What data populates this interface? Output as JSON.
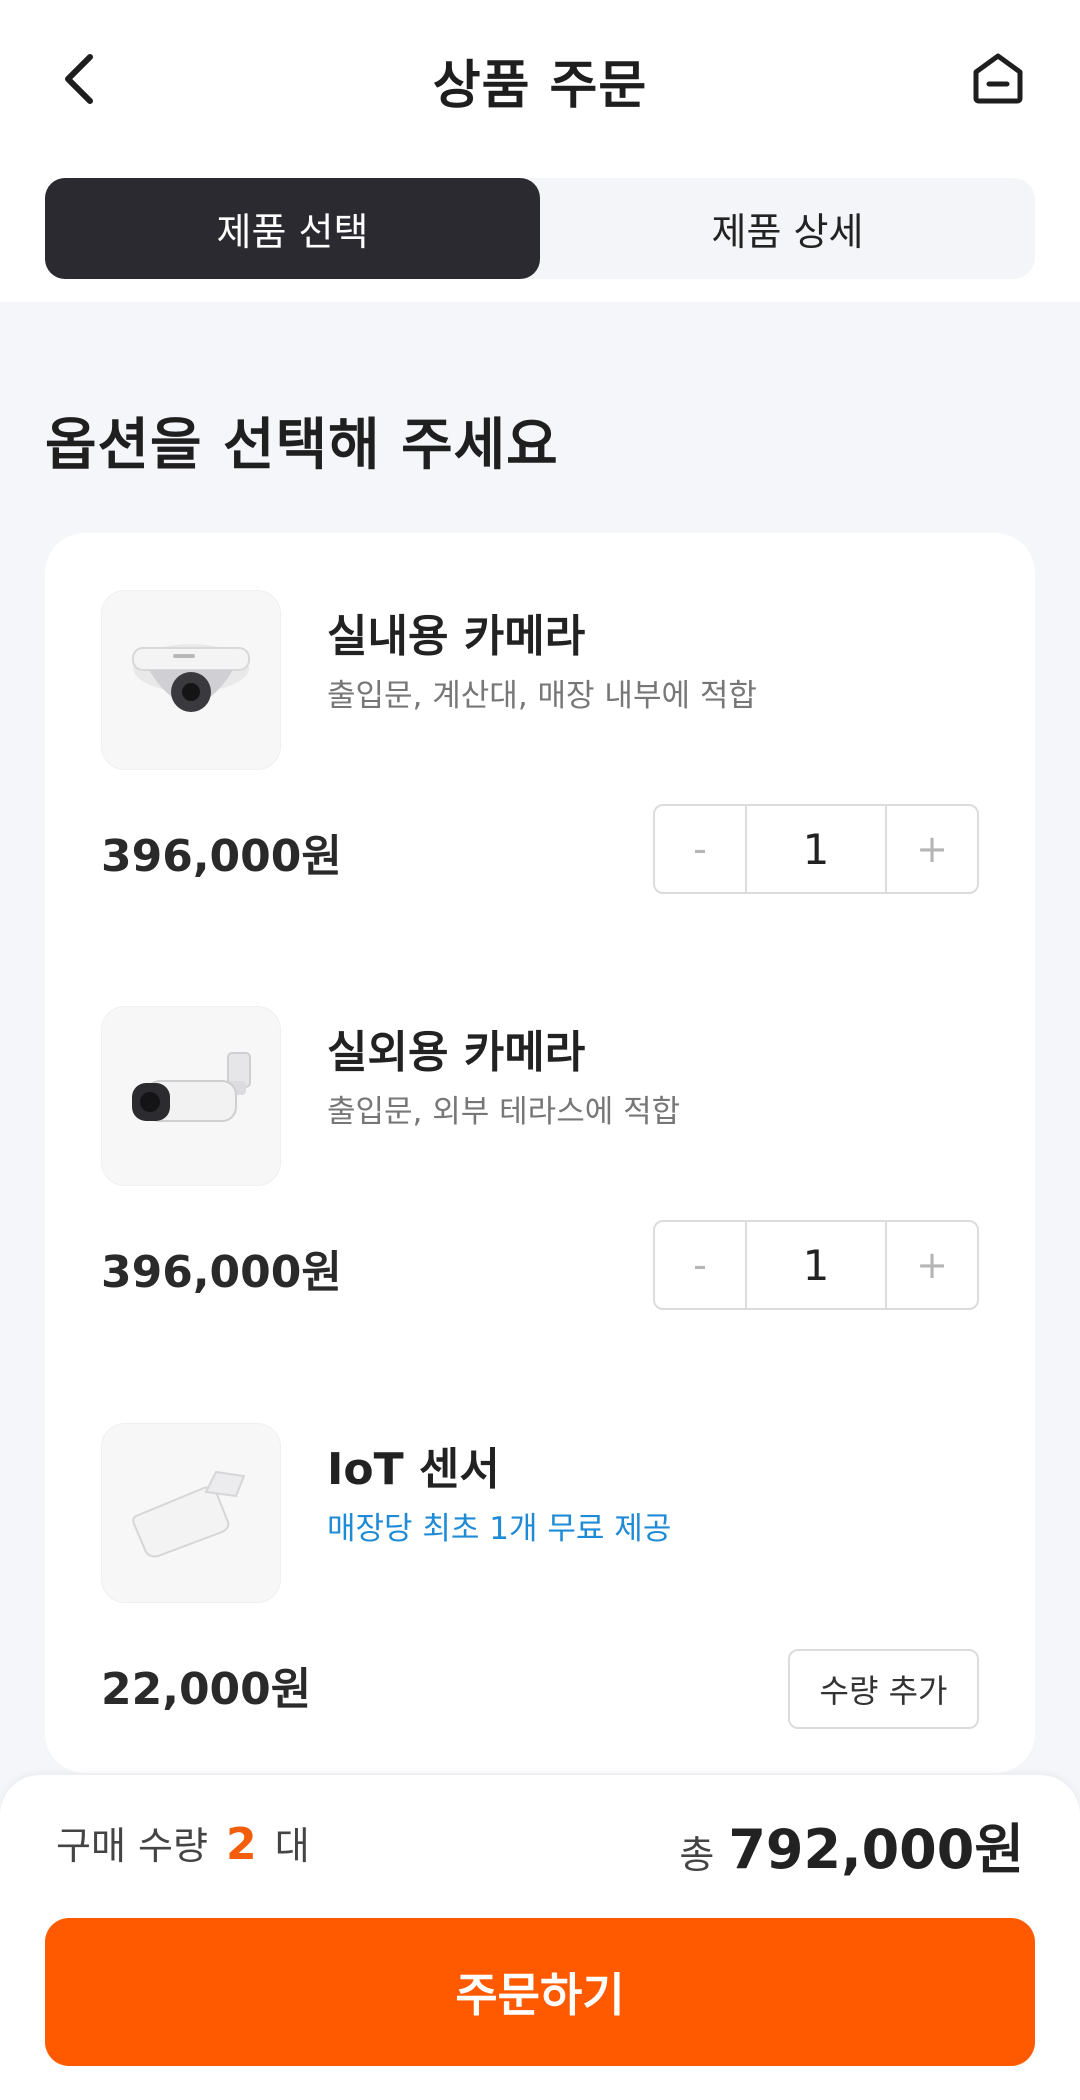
{
  "header": {
    "title": "상품 주문",
    "back_icon": "chevron-left-icon",
    "home_icon": "home-icon"
  },
  "tabs": [
    {
      "label": "제품 선택",
      "active": true
    },
    {
      "label": "제품 상세",
      "active": false
    }
  ],
  "section_title": "옵션을 선택해 주세요",
  "products": [
    {
      "name": "실내용 카메라",
      "desc": "출입문, 계산대, 매장 내부에 적합",
      "price": "396,000원",
      "quantity": "1",
      "minus": "-",
      "plus": "+"
    },
    {
      "name": "실외용 카메라",
      "desc": "출입문, 외부 테라스에 적합",
      "price": "396,000원",
      "quantity": "1",
      "minus": "-",
      "plus": "+"
    },
    {
      "name": "IoT 센서",
      "desc": "매장당 최초 1개 무료 제공",
      "price": "22,000원",
      "add_label": "수량 추가"
    }
  ],
  "summary": {
    "qty_prefix": "구매 수량",
    "qty_value": "2",
    "qty_suffix": "대",
    "total_label": "총",
    "total_value": "792,000원"
  },
  "order_button": "주문하기",
  "colors": {
    "accent": "#ff5a00",
    "dark_tab": "#2a2a30",
    "link_blue": "#1f8bd6"
  }
}
